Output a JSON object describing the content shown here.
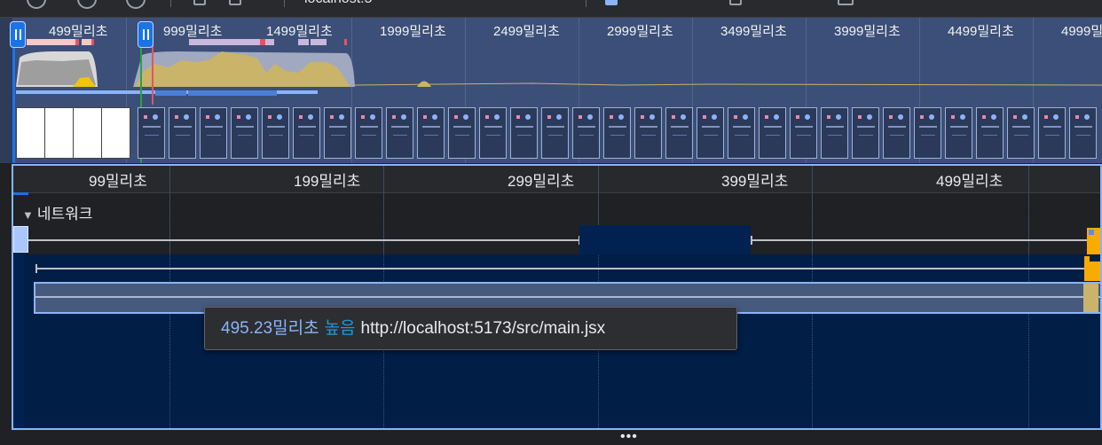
{
  "toolbar": {
    "url": "localhost:5"
  },
  "overview": {
    "time_labels": [
      "499밀리초",
      "999밀리초",
      "1499밀리초",
      "1999밀리초",
      "2499밀리초",
      "2999밀리초",
      "3499밀리초",
      "3999밀리초",
      "4499밀리초",
      "4999밀리초"
    ]
  },
  "main": {
    "time_labels": [
      "99밀리초",
      "199밀리초",
      "299밀리초",
      "399밀리초",
      "499밀리초"
    ],
    "track_title": "네트워크",
    "collapse_icon": "triangle-down-icon"
  },
  "tooltip": {
    "duration": "495.23밀리초",
    "priority": "높음",
    "url": "http://localhost:5173/src/main.jsx"
  },
  "colors": {
    "accent": "#8ab4f8",
    "selection_handle": "#1a73e8",
    "priority": "#1a9bd7",
    "network_block": "#012250",
    "overview_bg": "#3c4f78"
  }
}
